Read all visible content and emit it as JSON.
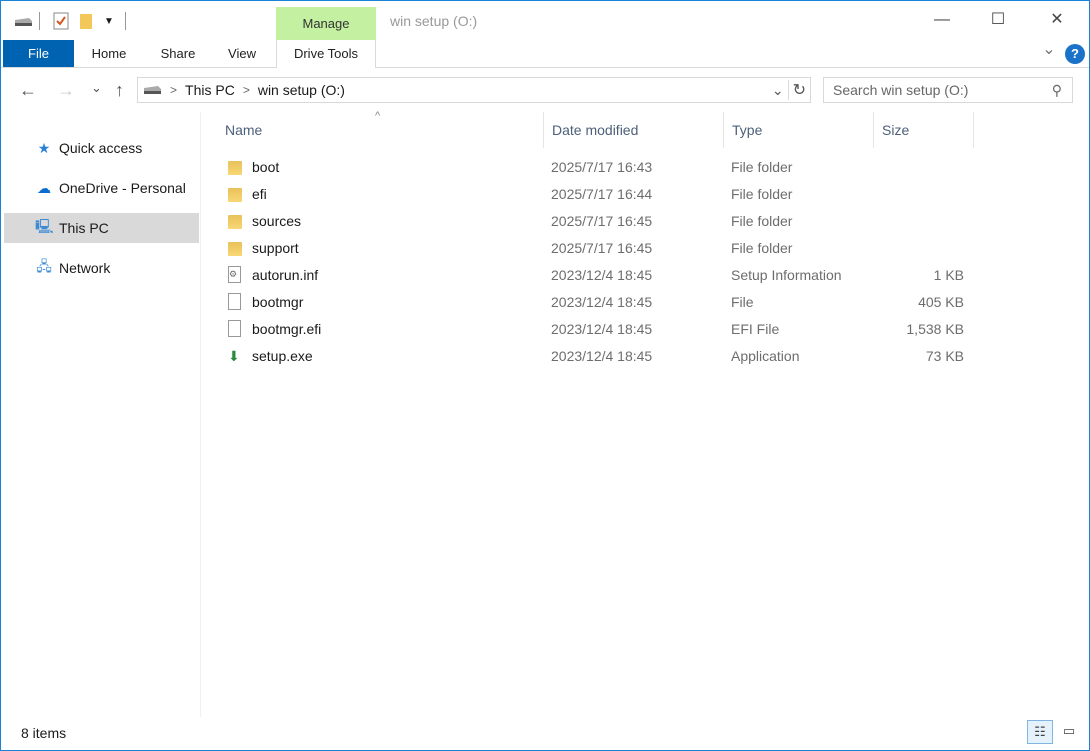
{
  "window": {
    "title": "win setup (O:)",
    "context_tab": "Manage",
    "minimize": "—",
    "maximize": "☐",
    "close": "✕"
  },
  "ribbon": {
    "tabs": [
      "File",
      "Home",
      "Share",
      "View",
      "Drive Tools"
    ],
    "expand": "⌄",
    "help": "?"
  },
  "nav": {
    "back": "←",
    "forward": "→",
    "recent": "⌄",
    "up": "↑",
    "breadcrumb": [
      "This PC",
      "win setup (O:)"
    ],
    "refresh": "↻",
    "dropdown": "⌄",
    "search_placeholder": "Search win setup (O:)"
  },
  "sidebar": {
    "items": [
      {
        "label": "Quick access",
        "icon": "star-icon"
      },
      {
        "label": "OneDrive - Personal",
        "icon": "cloud-icon"
      },
      {
        "label": "This PC",
        "icon": "computer-icon",
        "selected": true
      },
      {
        "label": "Network",
        "icon": "network-icon"
      }
    ]
  },
  "columns": [
    "Name",
    "Date modified",
    "Type",
    "Size"
  ],
  "files": [
    {
      "name": "boot",
      "date": "2025/7/17 16:43",
      "type": "File folder",
      "size": "",
      "icon": "folder"
    },
    {
      "name": "efi",
      "date": "2025/7/17 16:44",
      "type": "File folder",
      "size": "",
      "icon": "folder"
    },
    {
      "name": "sources",
      "date": "2025/7/17 16:45",
      "type": "File folder",
      "size": "",
      "icon": "folder"
    },
    {
      "name": "support",
      "date": "2025/7/17 16:45",
      "type": "File folder",
      "size": "",
      "icon": "folder"
    },
    {
      "name": "autorun.inf",
      "date": "2023/12/4 18:45",
      "type": "Setup Information",
      "size": "1 KB",
      "icon": "settings-file"
    },
    {
      "name": "bootmgr",
      "date": "2023/12/4 18:45",
      "type": "File",
      "size": "405 KB",
      "icon": "file"
    },
    {
      "name": "bootmgr.efi",
      "date": "2023/12/4 18:45",
      "type": "EFI File",
      "size": "1,538 KB",
      "icon": "file"
    },
    {
      "name": "setup.exe",
      "date": "2023/12/4 18:45",
      "type": "Application",
      "size": "73 KB",
      "icon": "setup-app"
    }
  ],
  "status": {
    "count": "8 items"
  }
}
